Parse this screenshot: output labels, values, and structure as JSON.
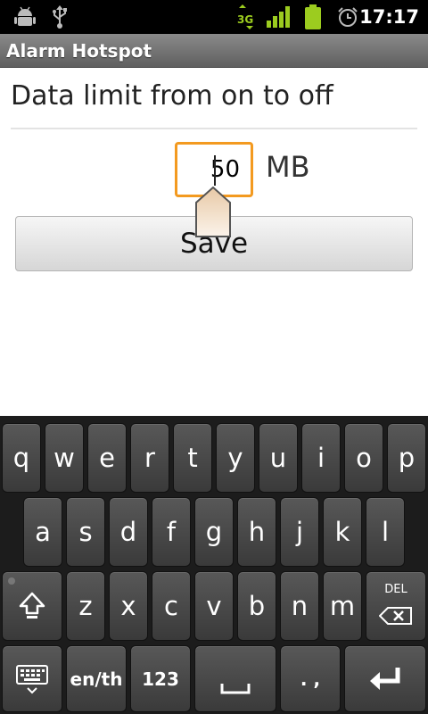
{
  "status_bar": {
    "time": "17:17",
    "network": "3G",
    "icons": [
      "android-debug-icon",
      "usb-icon",
      "3g-data-icon",
      "signal-icon",
      "battery-icon",
      "alarm-icon"
    ]
  },
  "app": {
    "title": "Alarm Hotspot"
  },
  "form": {
    "heading": "Data limit from on to off",
    "limit_value": "50",
    "unit": "MB",
    "save_label": "Save"
  },
  "keyboard": {
    "row1": [
      "q",
      "w",
      "e",
      "r",
      "t",
      "y",
      "u",
      "i",
      "o",
      "p"
    ],
    "row2": [
      "a",
      "s",
      "d",
      "f",
      "g",
      "h",
      "j",
      "k",
      "l"
    ],
    "row3": [
      "z",
      "x",
      "c",
      "v",
      "b",
      "n",
      "m"
    ],
    "delete_label": "DEL",
    "language_label": "en/th",
    "numbers_label": "123",
    "punct_label": ". ,"
  },
  "colors": {
    "focus": "#f39a20",
    "status_icon": "#9ccc1f"
  }
}
